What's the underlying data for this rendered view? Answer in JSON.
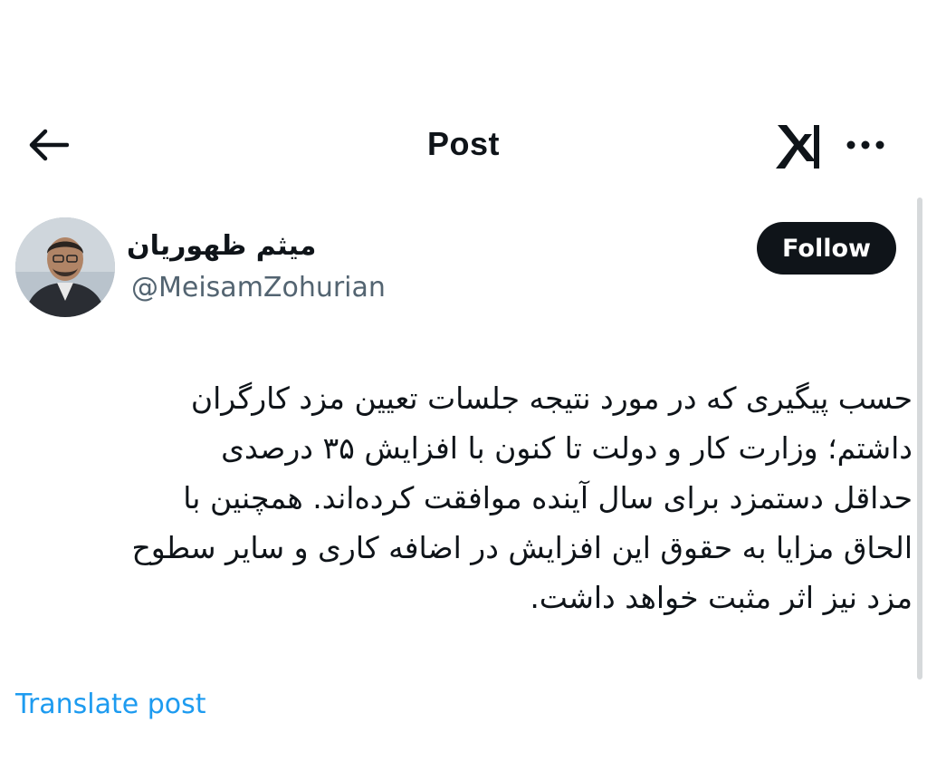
{
  "header": {
    "title": "Post",
    "back_icon": "arrow-left-icon",
    "logo_icon": "x-logo-icon",
    "more_icon": "more-horizontal-icon"
  },
  "author": {
    "display_name": "میثم ظهوریان",
    "handle": "@MeisamZohurian",
    "follow_label": "Follow"
  },
  "post": {
    "lines": [
      "حسب پیگیری که در مورد نتیجه جلسات تعیین مزد کارگران",
      "داشتم؛ وزارت کار و دولت تا کنون با افزایش ۳۵ درصدی",
      "حداقل دستمزد برای سال آینده موافقت کرده‌اند. همچنین با",
      "الحاق مزایا به حقوق این افزایش در اضافه کاری و سایر سطوح",
      "مزد نیز اثر مثبت خواهد داشت."
    ],
    "translate_label": "Translate post"
  },
  "colors": {
    "text": "#0f1419",
    "muted": "#536471",
    "link": "#1d9bf0",
    "button_bg": "#0f1419"
  }
}
